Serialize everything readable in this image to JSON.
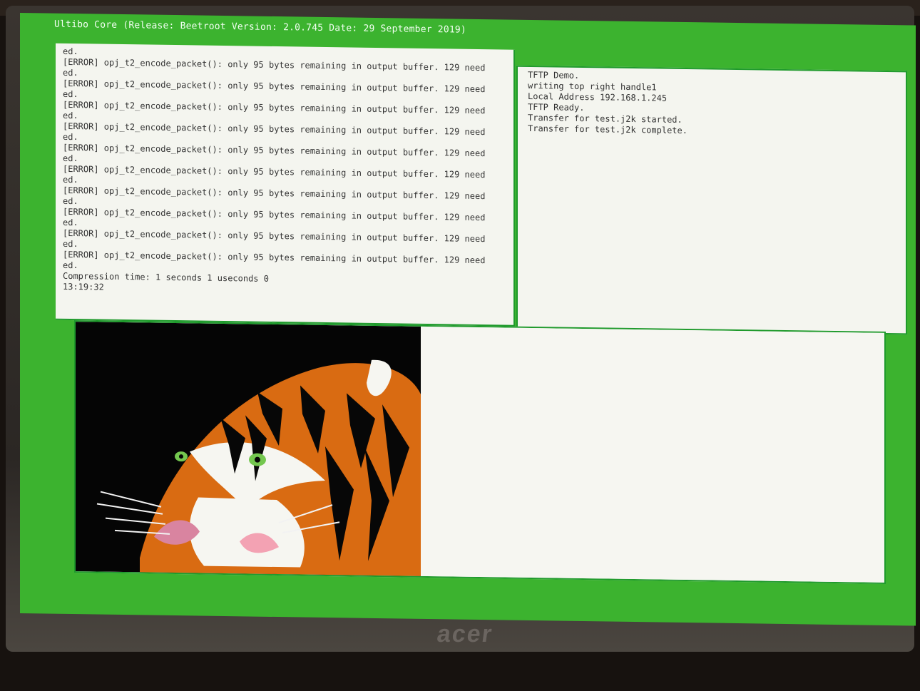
{
  "window": {
    "title": "Ultibo Core (Release: Beetroot Version: 2.0.745 Date: 29 September 2019)"
  },
  "log_panel": {
    "lines": [
      "ed.",
      "[ERROR] opj_t2_encode_packet(): only 95 bytes remaining in output buffer. 129 need",
      "ed.",
      "[ERROR] opj_t2_encode_packet(): only 95 bytes remaining in output buffer. 129 need",
      "ed.",
      "[ERROR] opj_t2_encode_packet(): only 95 bytes remaining in output buffer. 129 need",
      "ed.",
      "[ERROR] opj_t2_encode_packet(): only 95 bytes remaining in output buffer. 129 need",
      "ed.",
      "[ERROR] opj_t2_encode_packet(): only 95 bytes remaining in output buffer. 129 need",
      "ed.",
      "[ERROR] opj_t2_encode_packet(): only 95 bytes remaining in output buffer. 129 need",
      "ed.",
      "[ERROR] opj_t2_encode_packet(): only 95 bytes remaining in output buffer. 129 need",
      "ed.",
      "[ERROR] opj_t2_encode_packet(): only 95 bytes remaining in output buffer. 129 need",
      "ed.",
      "[ERROR] opj_t2_encode_packet(): only 95 bytes remaining in output buffer. 129 need",
      "ed.",
      "[ERROR] opj_t2_encode_packet(): only 95 bytes remaining in output buffer. 129 need",
      "ed.",
      "Compression time: 1 seconds 1 useconds 0",
      "13:19:32"
    ]
  },
  "tftp_panel": {
    "lines": [
      "TFTP Demo.",
      "writing top right handle1",
      "Local Address 192.168.1.245",
      "TFTP Ready.",
      "Transfer for test.j2k started.",
      "Transfer for test.j2k complete."
    ]
  },
  "monitor": {
    "brand": "acer"
  },
  "colors": {
    "screen_green": "#3cb32f",
    "panel_bg": "#f4f5ef",
    "text": "#343434"
  }
}
